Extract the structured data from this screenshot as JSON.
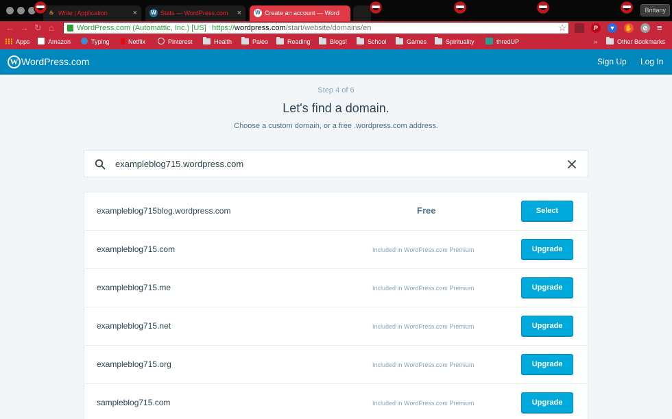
{
  "browser": {
    "tabs": [
      {
        "title": "Write | Application",
        "favicon": "flame-icon",
        "state": "inactive"
      },
      {
        "title": "Stats — WordPress.com",
        "favicon": "wordpress-icon",
        "state": "inactive"
      },
      {
        "title": "Create an account — Word",
        "favicon": "wordpress-icon",
        "state": "active"
      }
    ],
    "profile_name": "Brittany",
    "address": {
      "ev_label": "WordPress.com (Automattic, Inc.) [US]",
      "scheme": "https://",
      "host": "wordpress.com",
      "path": "/start/website/domains/en"
    },
    "bookmarks": [
      {
        "label": "Apps",
        "icon": "apps-grid-icon"
      },
      {
        "label": "Amazon",
        "icon": "amazon-icon"
      },
      {
        "label": "Typing",
        "icon": "typing-icon"
      },
      {
        "label": "Netflix",
        "icon": "netflix-icon"
      },
      {
        "label": "Pinterest",
        "icon": "pinterest-icon"
      },
      {
        "label": "Health",
        "icon": "folder-icon"
      },
      {
        "label": "Paleo",
        "icon": "folder-icon"
      },
      {
        "label": "Reading",
        "icon": "folder-icon"
      },
      {
        "label": "Blogs!",
        "icon": "folder-icon"
      },
      {
        "label": "School",
        "icon": "folder-icon"
      },
      {
        "label": "Games",
        "icon": "folder-icon"
      },
      {
        "label": "Spirituality",
        "icon": "folder-icon"
      },
      {
        "label": "thredUP",
        "icon": "thredup-icon"
      }
    ],
    "overflow_label": "»",
    "other_bookmarks": "Other Bookmarks",
    "colors": {
      "chrome_red": "#c7273a",
      "tab_active": "#e03a46"
    }
  },
  "masterbar": {
    "brand": "WordPress.com",
    "sign_up": "Sign Up",
    "log_in": "Log In",
    "color": "#0087be"
  },
  "signup": {
    "step": "Step 4 of 6",
    "headline": "Let's find a domain.",
    "subheadline": "Choose a custom domain, or a free .wordpress.com address.",
    "search": {
      "value": "exampleblog715.wordpress.com"
    }
  },
  "results": [
    {
      "domain": "exampleblog715blog.wordpress.com",
      "price": "Free",
      "button": "Select"
    },
    {
      "domain": "exampleblog715.com",
      "price": "Included in WordPress.com Premium",
      "button": "Upgrade"
    },
    {
      "domain": "exampleblog715.me",
      "price": "Included in WordPress.com Premium",
      "button": "Upgrade"
    },
    {
      "domain": "exampleblog715.net",
      "price": "Included in WordPress.com Premium",
      "button": "Upgrade"
    },
    {
      "domain": "exampleblog715.org",
      "price": "Included in WordPress.com Premium",
      "button": "Upgrade"
    },
    {
      "domain": "sampleblog715.com",
      "price": "Included in WordPress.com Premium",
      "button": "Upgrade"
    }
  ],
  "accent_color": "#00aadc"
}
